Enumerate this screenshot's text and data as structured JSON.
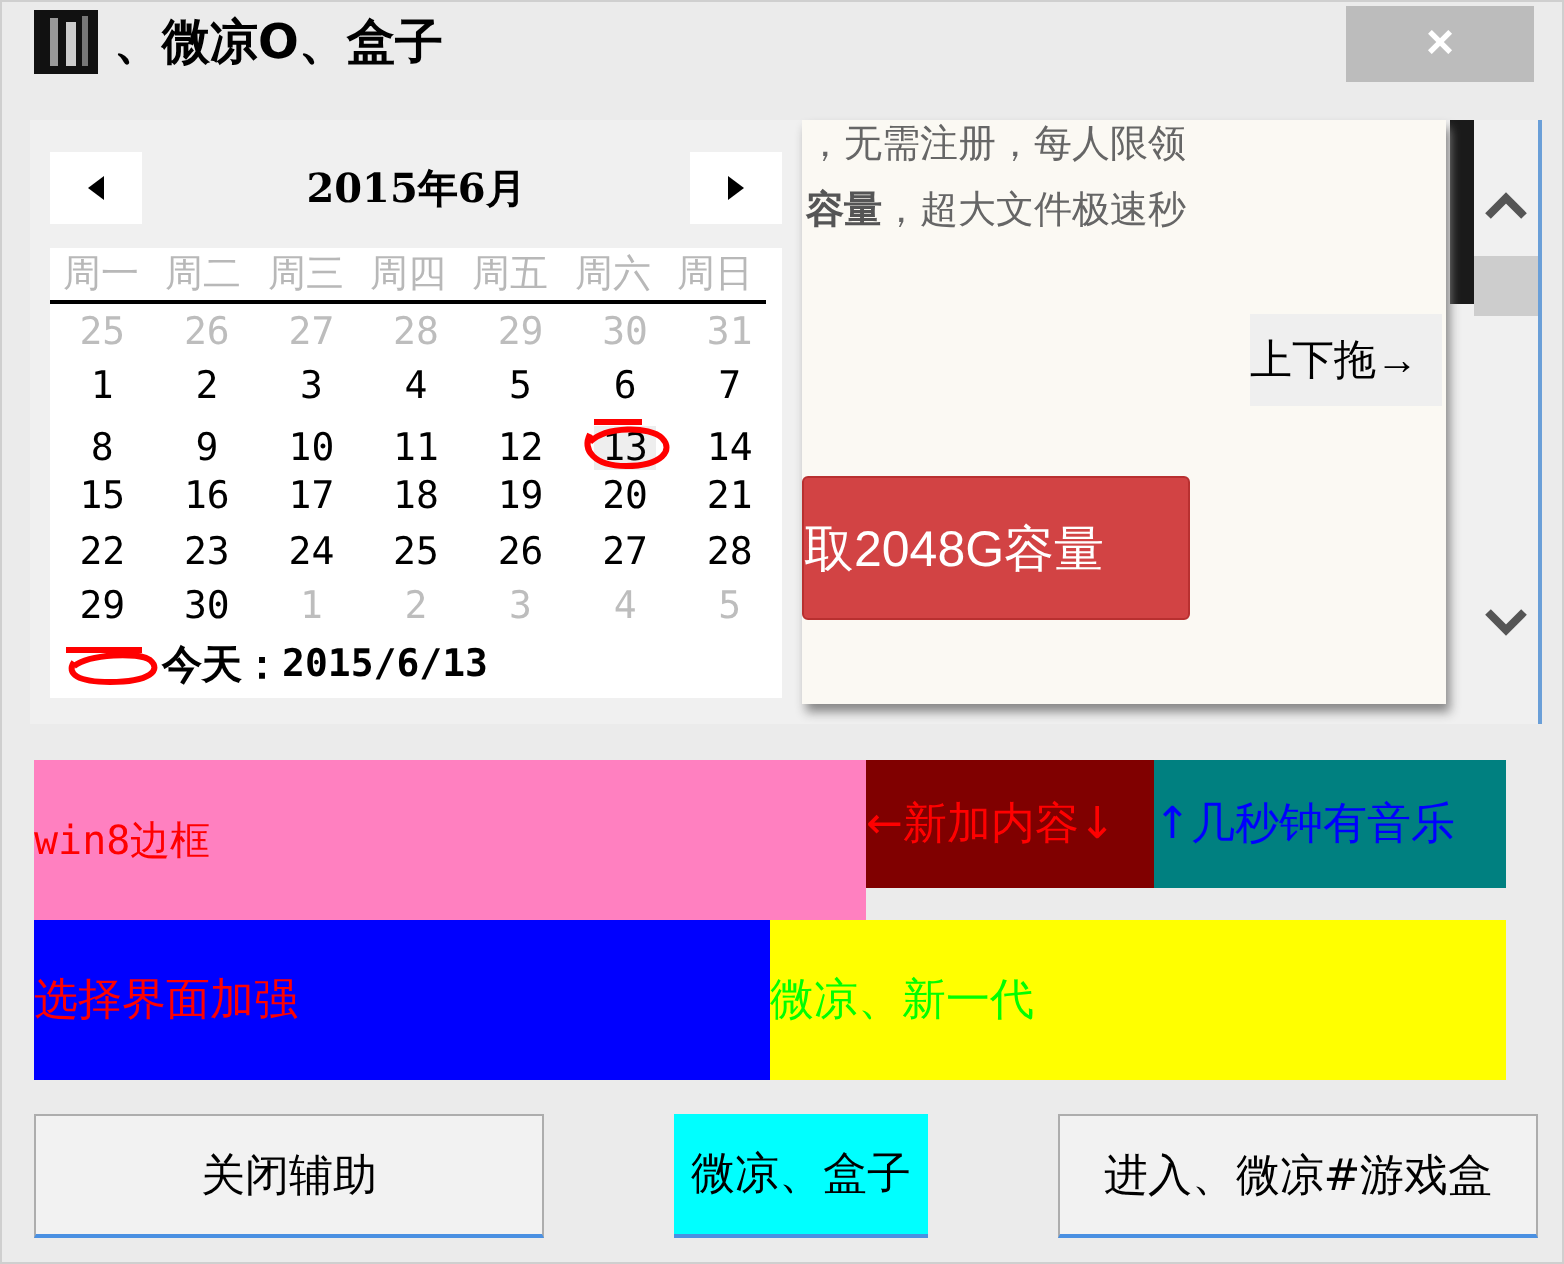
{
  "window": {
    "title": "、微凉O、盒子",
    "close": "×"
  },
  "calendar": {
    "title": "2015年6月",
    "weekdays": [
      "周一",
      "周二",
      "周三",
      "周四",
      "周五",
      "周六",
      "周日"
    ],
    "weeks": [
      [
        {
          "day": "25",
          "muted": true,
          "selected": false
        },
        {
          "day": "26",
          "muted": true,
          "selected": false
        },
        {
          "day": "27",
          "muted": true,
          "selected": false
        },
        {
          "day": "28",
          "muted": true,
          "selected": false
        },
        {
          "day": "29",
          "muted": true,
          "selected": false
        },
        {
          "day": "30",
          "muted": true,
          "selected": false
        },
        {
          "day": "31",
          "muted": true,
          "selected": false
        }
      ],
      [
        {
          "day": "1",
          "muted": false,
          "selected": false
        },
        {
          "day": "2",
          "muted": false,
          "selected": false
        },
        {
          "day": "3",
          "muted": false,
          "selected": false
        },
        {
          "day": "4",
          "muted": false,
          "selected": false
        },
        {
          "day": "5",
          "muted": false,
          "selected": false
        },
        {
          "day": "6",
          "muted": false,
          "selected": false
        },
        {
          "day": "7",
          "muted": false,
          "selected": false
        }
      ],
      [
        {
          "day": "8",
          "muted": false,
          "selected": false
        },
        {
          "day": "9",
          "muted": false,
          "selected": false
        },
        {
          "day": "10",
          "muted": false,
          "selected": false
        },
        {
          "day": "11",
          "muted": false,
          "selected": false
        },
        {
          "day": "12",
          "muted": false,
          "selected": false
        },
        {
          "day": "13",
          "muted": false,
          "selected": true
        },
        {
          "day": "14",
          "muted": false,
          "selected": false
        }
      ],
      [
        {
          "day": "15",
          "muted": false,
          "selected": false
        },
        {
          "day": "16",
          "muted": false,
          "selected": false
        },
        {
          "day": "17",
          "muted": false,
          "selected": false
        },
        {
          "day": "18",
          "muted": false,
          "selected": false
        },
        {
          "day": "19",
          "muted": false,
          "selected": false
        },
        {
          "day": "20",
          "muted": false,
          "selected": false
        },
        {
          "day": "21",
          "muted": false,
          "selected": false
        }
      ],
      [
        {
          "day": "22",
          "muted": false,
          "selected": false
        },
        {
          "day": "23",
          "muted": false,
          "selected": false
        },
        {
          "day": "24",
          "muted": false,
          "selected": false
        },
        {
          "day": "25",
          "muted": false,
          "selected": false
        },
        {
          "day": "26",
          "muted": false,
          "selected": false
        },
        {
          "day": "27",
          "muted": false,
          "selected": false
        },
        {
          "day": "28",
          "muted": false,
          "selected": false
        }
      ],
      [
        {
          "day": "29",
          "muted": false,
          "selected": false
        },
        {
          "day": "30",
          "muted": false,
          "selected": false
        },
        {
          "day": "1",
          "muted": true,
          "selected": false
        },
        {
          "day": "2",
          "muted": true,
          "selected": false
        },
        {
          "day": "3",
          "muted": true,
          "selected": false
        },
        {
          "day": "4",
          "muted": true,
          "selected": false
        },
        {
          "day": "5",
          "muted": true,
          "selected": false
        }
      ]
    ],
    "today_label": "今天：",
    "today_date": "2015/6/13"
  },
  "web_page": {
    "lines": [
      "，无需注册，每人限领",
      "**容量**，超大文件极速秒"
    ],
    "drag_label": "上下拖→",
    "claim_button": "取2048G容量"
  },
  "blocks": [
    {
      "color": "#ff80c0",
      "label": {
        "text": "win8边框",
        "color": "#ff0000"
      }
    },
    {
      "color": "#800000",
      "label": {
        "text": "←新加内容↓",
        "color": "#ff0000"
      }
    },
    {
      "color": "#008080",
      "label": {
        "text": "↑几秒钟有音乐",
        "color": "#0000ff"
      }
    },
    {
      "color": "#0000ff",
      "label": {
        "text": "选择界面加强",
        "color": "#ff0000"
      }
    },
    {
      "color": "#ffff00",
      "label": {
        "text": "微凉、新一代",
        "color": "#00ff00"
      }
    }
  ],
  "buttons": [
    {
      "label": "关闭辅助",
      "kind": "plain"
    },
    {
      "label": "微凉、盒子",
      "kind": "highlight"
    },
    {
      "label": "进入、微凉#游戏盒",
      "kind": "plain"
    }
  ]
}
